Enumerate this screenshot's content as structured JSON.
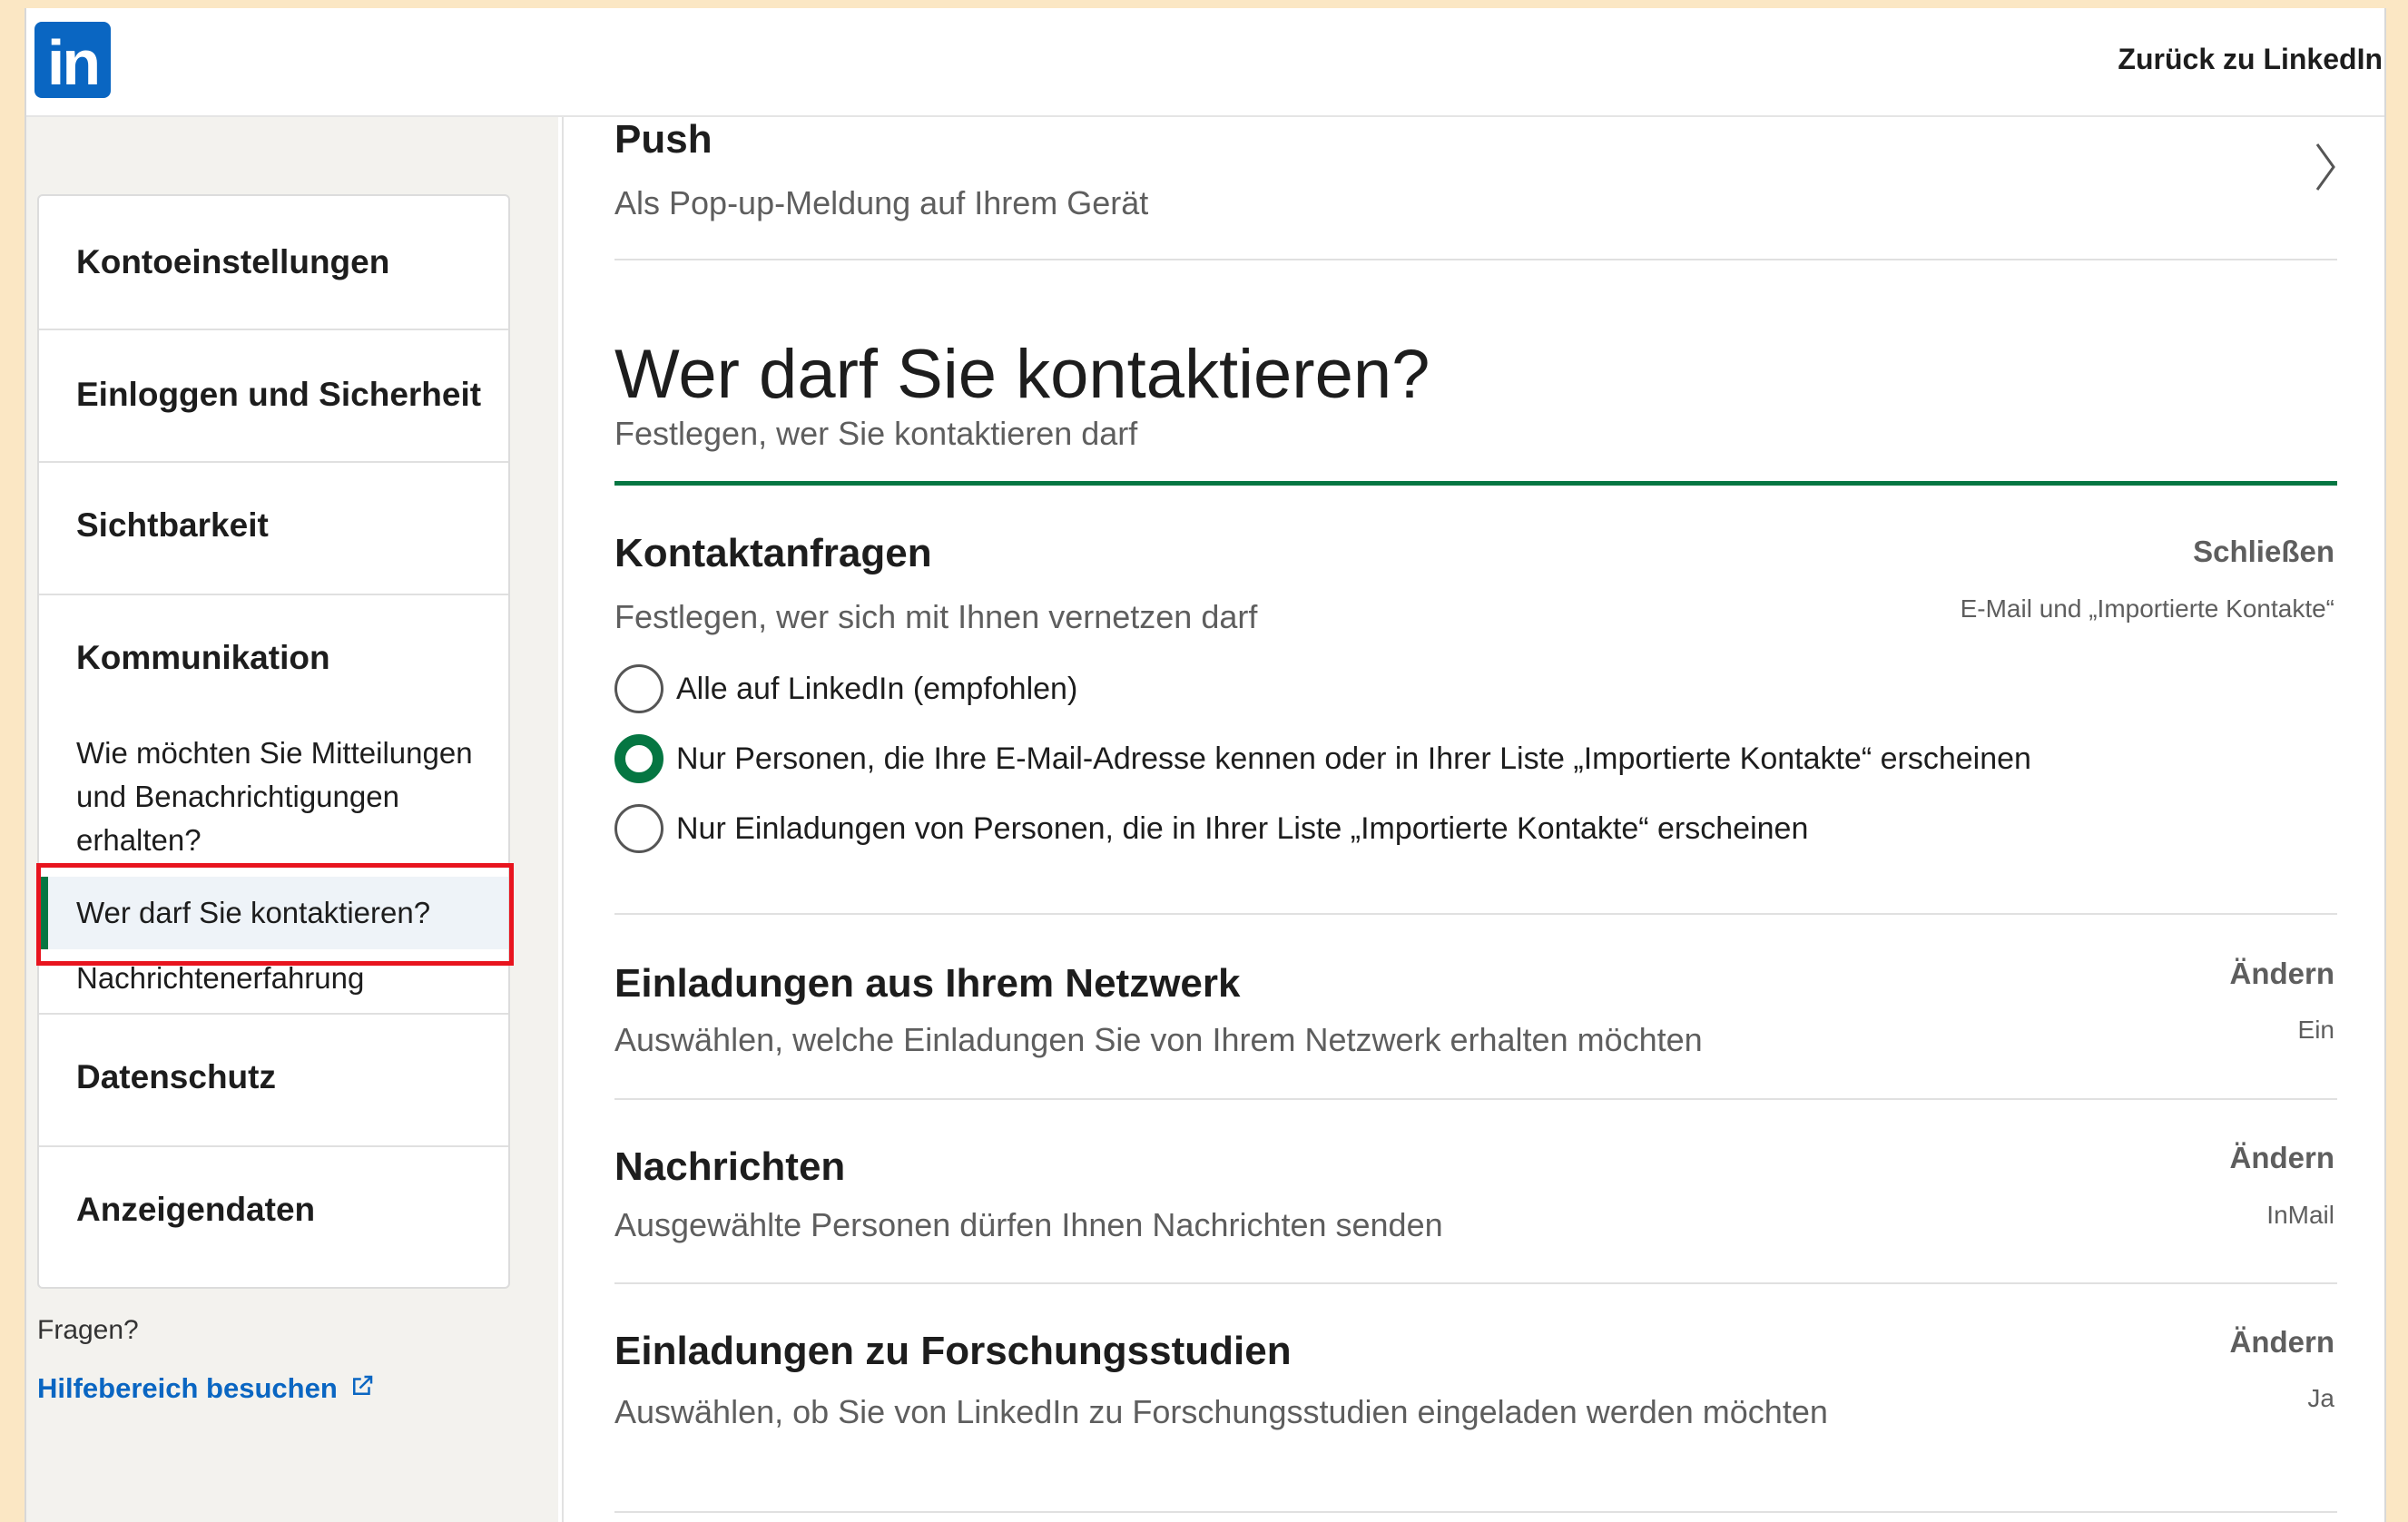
{
  "topbar": {
    "logo_text": "in",
    "back_link": "Zurück zu LinkedIn"
  },
  "sidebar": {
    "sections": [
      {
        "label": "Kontoeinstellungen"
      },
      {
        "label": "Einloggen und Sicherheit"
      },
      {
        "label": "Sichtbarkeit"
      },
      {
        "label": "Kommunikation"
      }
    ],
    "comm_items": [
      "Wie möchten Sie Mitteilungen und Benachrichtigungen erhalten?",
      "Wer darf Sie kontaktieren?",
      "Nachrichtenerfahrung"
    ],
    "more_sections": [
      {
        "label": "Datenschutz"
      },
      {
        "label": "Anzeigendaten"
      }
    ],
    "questions": "Fragen?",
    "help_link": "Hilfebereich besuchen",
    "highlight_color": "#e8141e",
    "active_color": "#057642"
  },
  "content": {
    "push": {
      "title": "Push",
      "subtitle": "Als Pop-up-Meldung auf Ihrem Gerät"
    },
    "section": {
      "title": "Wer darf Sie kontaktieren?",
      "subtitle": "Festlegen, wer Sie kontaktieren darf"
    },
    "contact_requests": {
      "title": "Kontaktanfragen",
      "action": "Schließen",
      "value": "E-Mail und „Importierte Kontakte“",
      "subtitle": "Festlegen, wer sich mit Ihnen vernetzen darf",
      "options": [
        {
          "label": "Alle auf LinkedIn (empfohlen)",
          "checked": false
        },
        {
          "label": "Nur Personen, die Ihre E-Mail-Adresse kennen oder in Ihrer Liste „Importierte Kontakte“ erscheinen",
          "checked": true
        },
        {
          "label": "Nur Einladungen von Personen, die in Ihrer Liste „Importierte Kontakte“ erscheinen",
          "checked": false
        }
      ]
    },
    "rows": [
      {
        "title": "Einladungen aus Ihrem Netzwerk",
        "subtitle": "Auswählen, welche Einladungen Sie von Ihrem Netzwerk erhalten möchten",
        "action": "Ändern",
        "value": "Ein"
      },
      {
        "title": "Nachrichten",
        "subtitle": "Ausgewählte Personen dürfen Ihnen Nachrichten senden",
        "action": "Ändern",
        "value": "InMail"
      },
      {
        "title": "Einladungen zu Forschungsstudien",
        "subtitle": "Auswählen, ob Sie von LinkedIn zu Forschungsstudien eingeladen werden möchten",
        "action": "Ändern",
        "value": "Ja"
      }
    ]
  }
}
